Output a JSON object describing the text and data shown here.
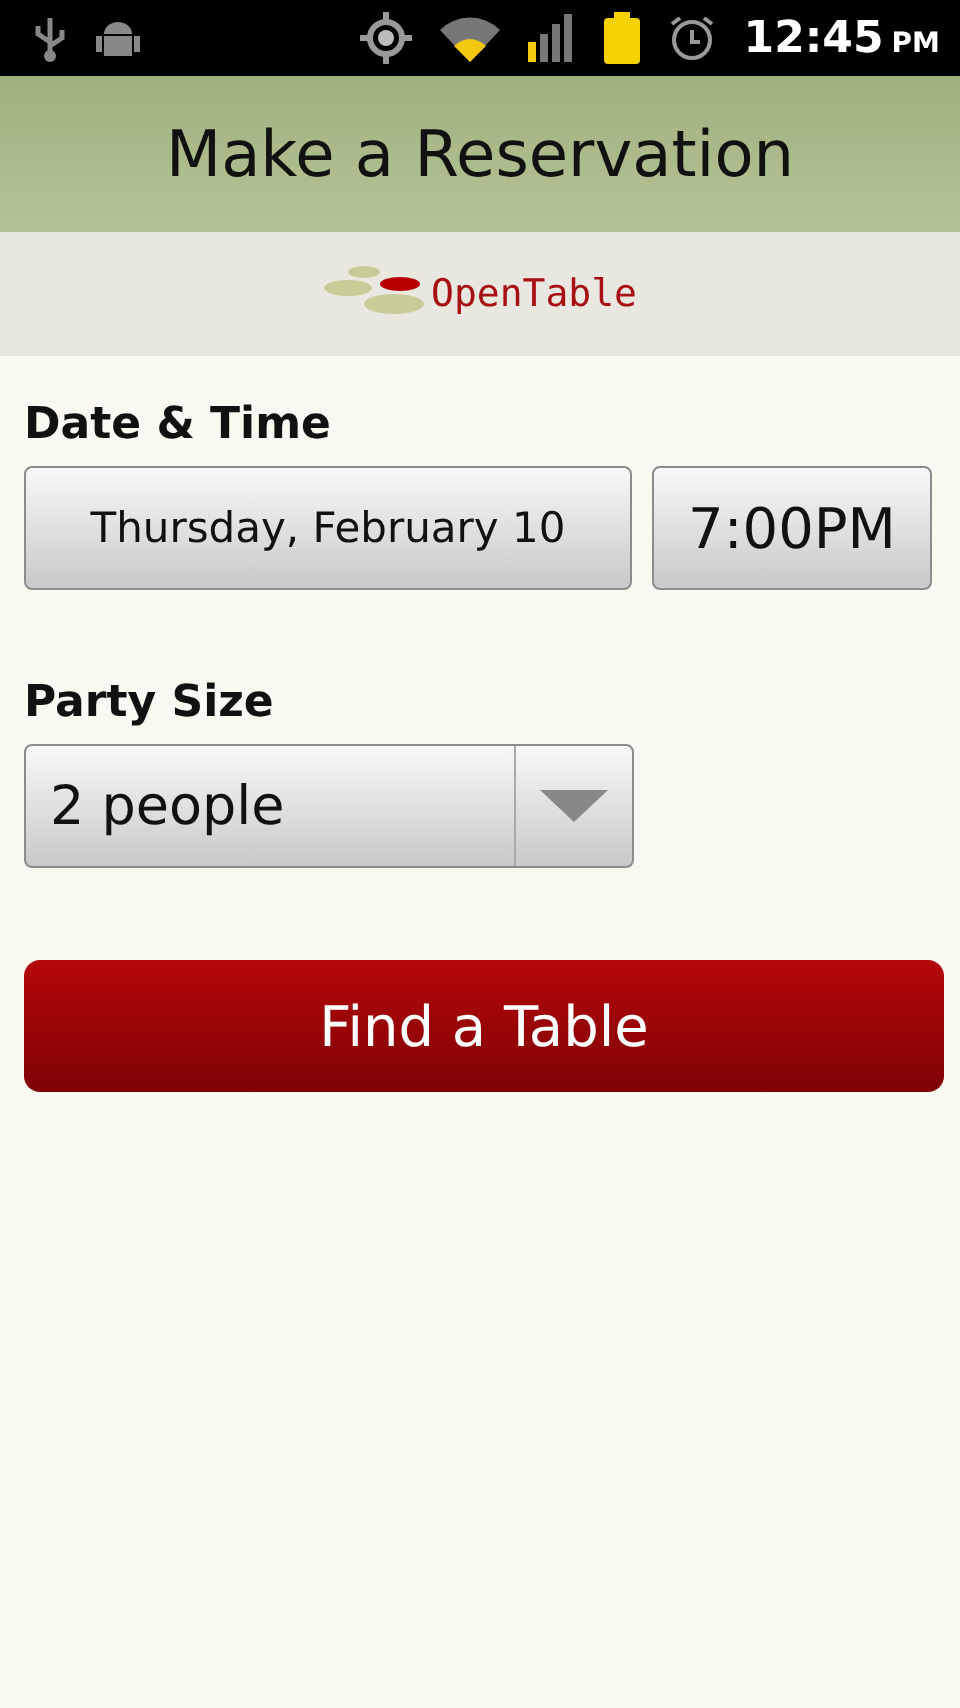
{
  "status_bar": {
    "time": "12:45",
    "period": "PM"
  },
  "title": "Make a Reservation",
  "brand": {
    "name": "OpenTable"
  },
  "date_time": {
    "label": "Date & Time",
    "date": "Thursday, February 10",
    "time": "7:00PM"
  },
  "party_size": {
    "label": "Party Size",
    "value": "2 people"
  },
  "action": {
    "label": "Find a Table"
  }
}
